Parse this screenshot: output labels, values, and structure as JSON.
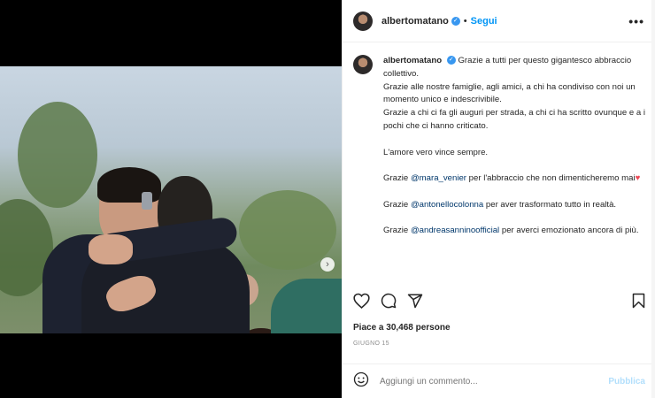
{
  "post": {
    "username": "albertomatano",
    "follow_label": "Segui",
    "separator": "•",
    "more_label": "•••",
    "verified_mark": "✓"
  },
  "caption": {
    "username": "albertomatano",
    "paragraphs": {
      "p1": "Grazie a tutti per questo gigantesco abbraccio collettivo.",
      "p2": "Grazie alle nostre famiglie, agli amici, a chi ha condiviso con noi un momento unico e indescrivibile.",
      "p3": "Grazie a chi ci fa gli auguri per strada, a chi ci ha scritto ovunque e a i pochi che ci hanno criticato.",
      "p4": "L'amore vero vince sempre.",
      "p5_before": "Grazie ",
      "p5_mention": "@mara_venier",
      "p5_after": " per l'abbraccio che non dimenticheremo mai",
      "p5_heart": "♥",
      "p6_before": "Grazie ",
      "p6_mention": "@antonellocolonna",
      "p6_after": " per aver trasformato tutto in realtà.",
      "p7_before": "Grazie ",
      "p7_mention": "@andreasanninoofficial",
      "p7_after": " per averci emozionato ancora di più."
    }
  },
  "actions": {
    "like_icon": "heart-outline-icon",
    "comment_icon": "comment-icon",
    "share_icon": "send-icon",
    "save_icon": "bookmark-icon"
  },
  "likes_text": "Piace a 30,468 persone",
  "date_text": "GIUGNO 15",
  "comment": {
    "placeholder": "Aggiungi un commento...",
    "publish_label": "Pubblica",
    "emoji_icon": "smiley-icon"
  },
  "carousel": {
    "next_label": "›",
    "total_slides": 11,
    "active_index": 0
  },
  "colors": {
    "accent": "#0095f6",
    "verified": "#3897f0",
    "mention": "#00376b",
    "heart": "#ed4956",
    "publish_disabled": "#b2dffc"
  }
}
